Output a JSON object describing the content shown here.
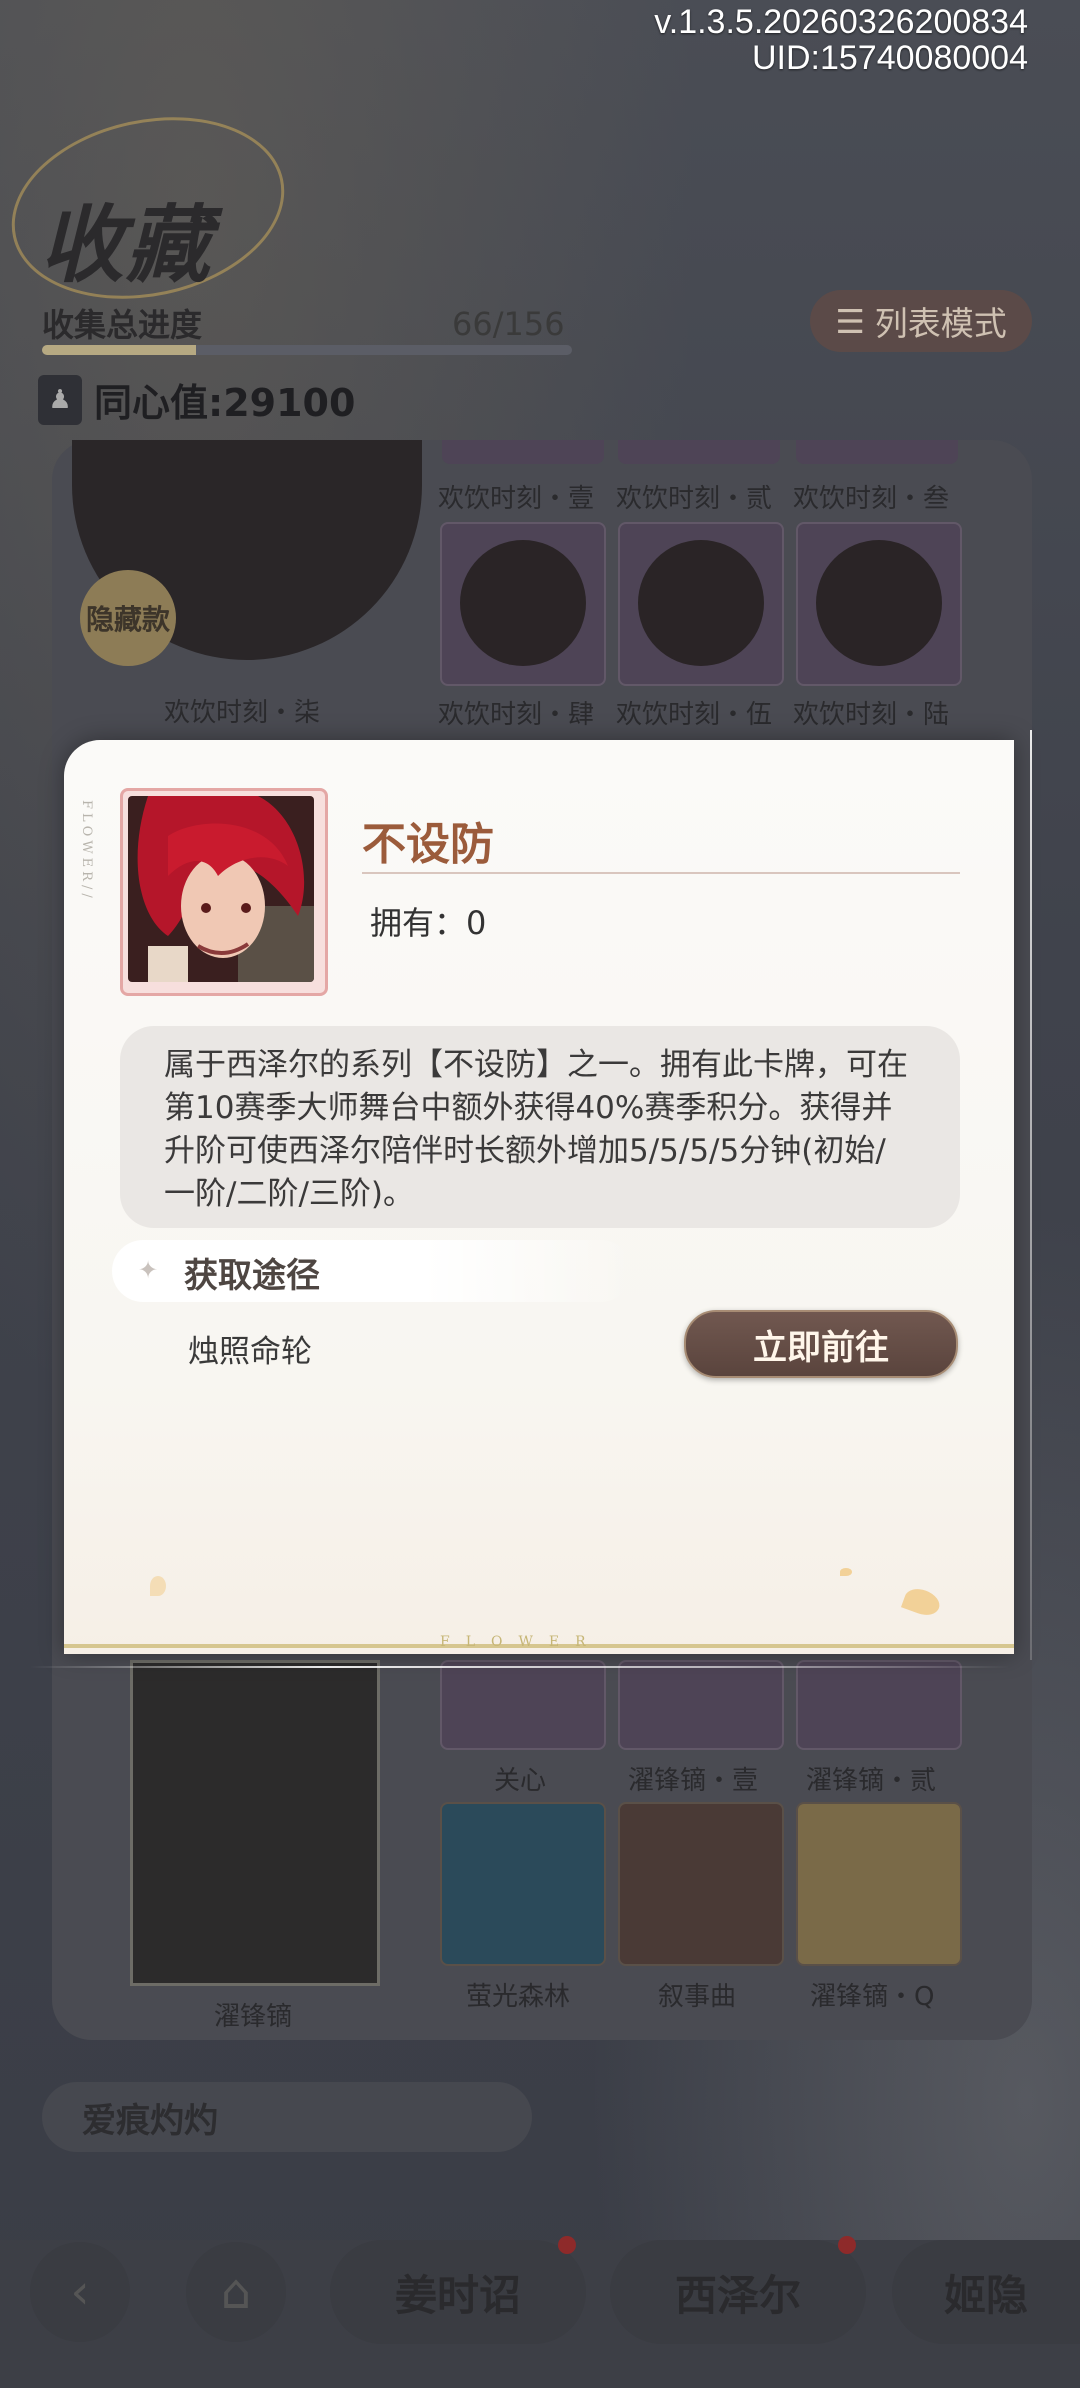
{
  "version": {
    "build": "v.1.3.5.20260326200834",
    "uid": "UID:15740080004"
  },
  "header": {
    "title": "收藏",
    "progress_label": "收集总进度",
    "progress_count": "66/156",
    "progress_fraction": 0.29,
    "list_mode_label": "列表模式",
    "affinity_label": "同心值:29100"
  },
  "collection": {
    "hidden_badge": "隐藏款",
    "big_item_label": "欢饮时刻・柒",
    "row1_labels": [
      "欢饮时刻・壹",
      "欢饮时刻・贰",
      "欢饮时刻・叁"
    ],
    "row2_labels": [
      "欢饮时刻・肆",
      "欢饮时刻・伍",
      "欢饮时刻・陆"
    ],
    "lower_big_label": "濯锋镝",
    "row3_labels": [
      "关心",
      "濯锋镝・壹",
      "濯锋镝・贰"
    ],
    "row4_labels": [
      "萤光森林",
      "叙事曲",
      "濯锋镝・Q"
    ],
    "next_section_title": "爱痕灼灼"
  },
  "modal": {
    "item_name": "不设防",
    "owned_label": "拥有：0",
    "description": "属于西泽尔的系列【不设防】之一。拥有此卡牌，可在第10赛季大师舞台中额外获得40%赛季积分。获得并升阶可使西泽尔陪伴时长额外增加5/5/5/5分钟(初始/一阶/二阶/三阶)。",
    "acquire_title": "获取途径",
    "source_name": "烛照命轮",
    "go_button": "立即前往",
    "side_text": "FLOWER//",
    "footer_text": "FLOWER"
  },
  "nav": {
    "tabs": [
      "姜时诏",
      "西泽尔",
      "姬隐"
    ]
  },
  "colors": {
    "accent_brown": "#5a443d",
    "title_red": "#9b5b3b",
    "dot_red": "#8e2a2a"
  }
}
